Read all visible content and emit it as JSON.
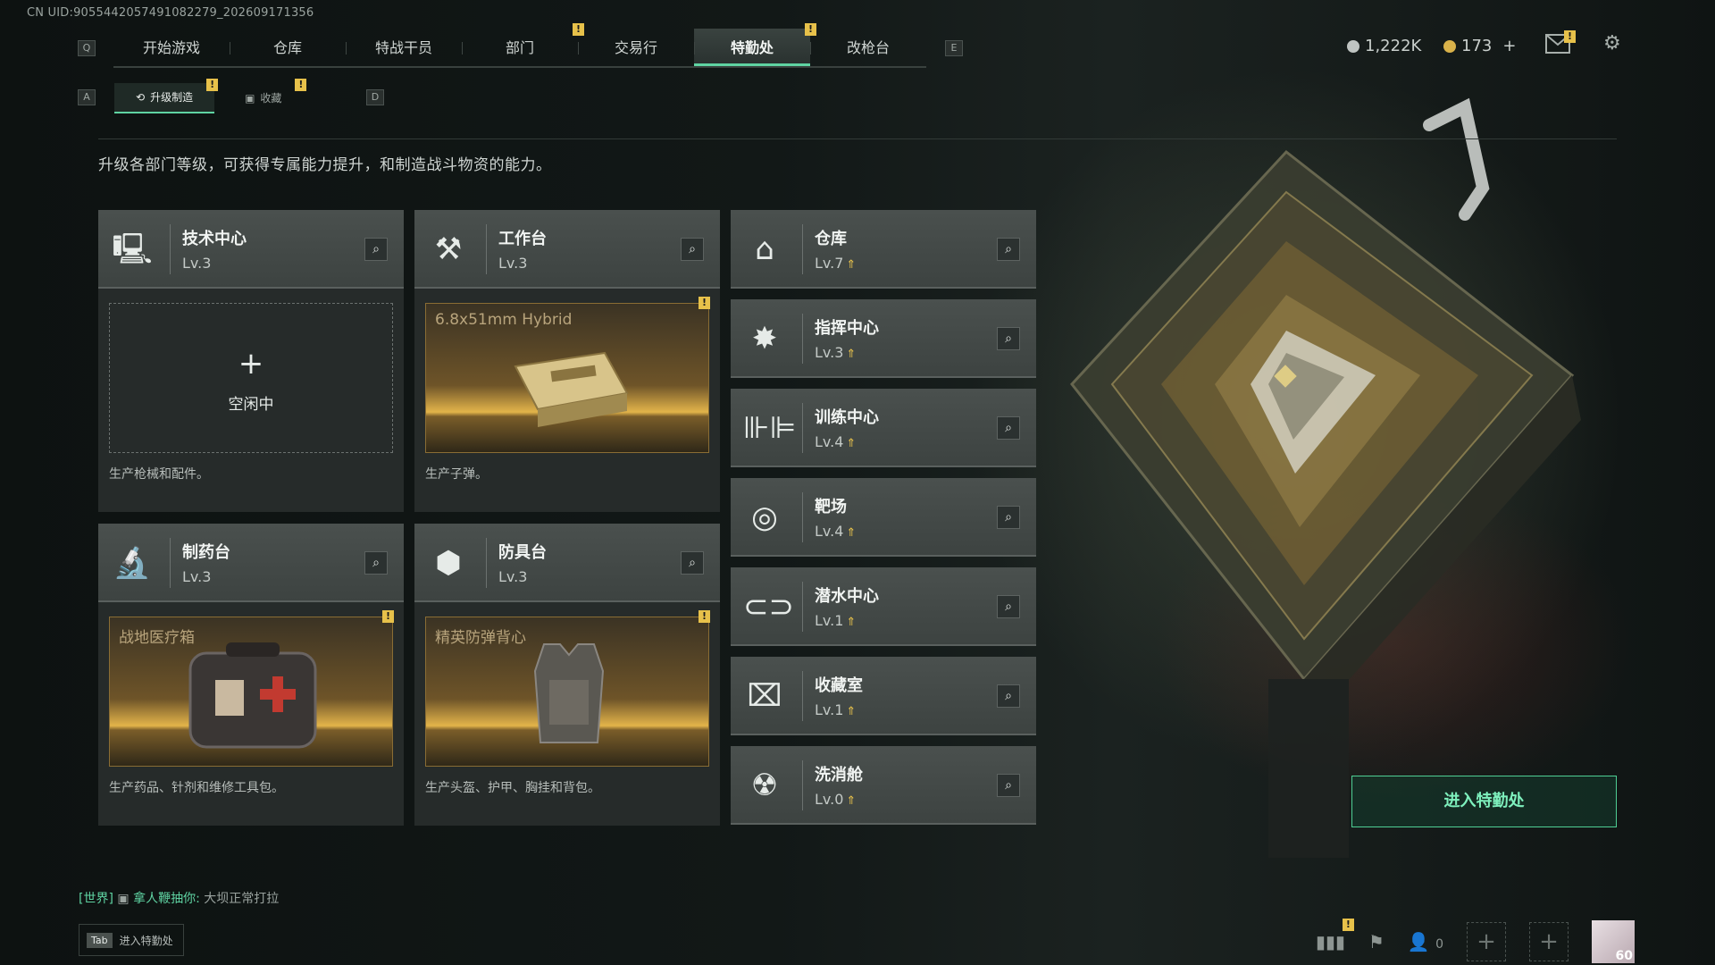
{
  "uid": "CN UID:9055442057491082279_202609171356",
  "nav": {
    "left_key": "Q",
    "right_key": "E",
    "tabs": [
      {
        "label": "开始游戏",
        "active": false,
        "badge": ""
      },
      {
        "label": "仓库",
        "active": false,
        "badge": ""
      },
      {
        "label": "特战干员",
        "active": false,
        "badge": ""
      },
      {
        "label": "部门",
        "active": false,
        "badge": "!"
      },
      {
        "label": "交易行",
        "active": false,
        "badge": ""
      },
      {
        "label": "特勤处",
        "active": true,
        "badge": "!"
      },
      {
        "label": "改枪台",
        "active": false,
        "badge": ""
      }
    ]
  },
  "currency": {
    "silver": "1,222K",
    "gold": "173",
    "gold_add": "+",
    "silver_color": "#bfc4c2",
    "gold_color": "#d9b24a"
  },
  "mail_badge": "!",
  "icons": {
    "mail": "mail-icon",
    "settings": "gear-icon"
  },
  "subnav": {
    "left_key": "A",
    "right_key": "D",
    "tabs": [
      {
        "label": "升级制造",
        "active": true,
        "badge": "!",
        "icon": "upgrade-icon"
      },
      {
        "label": "收藏",
        "active": false,
        "badge": "!",
        "icon": "collection-icon"
      }
    ]
  },
  "description": "升级各部门等级，可获得专属能力提升，和制造战斗物资的能力。",
  "production_cards": [
    {
      "name": "技术中心",
      "level": "Lv.3",
      "icon": "computer-icon",
      "state": "idle",
      "idle_label": "空闲中",
      "item": "",
      "footer": "生产枪械和配件。"
    },
    {
      "name": "工作台",
      "level": "Lv.3",
      "icon": "tools-icon",
      "state": "producing",
      "item": "6.8x51mm Hybrid",
      "footer": "生产子弹。"
    },
    {
      "name": "制药台",
      "level": "Lv.3",
      "icon": "microscope-icon",
      "state": "producing",
      "item": "战地医疗箱",
      "footer": "生产药品、针剂和维修工具包。"
    },
    {
      "name": "防具台",
      "level": "Lv.3",
      "icon": "cubes-icon",
      "state": "producing",
      "item": "精英防弹背心",
      "footer": "生产头盔、护甲、胸挂和背包。"
    }
  ],
  "facility_cards": [
    {
      "name": "仓库",
      "level": "Lv.7",
      "icon": "warehouse-icon"
    },
    {
      "name": "指挥中心",
      "level": "Lv.3",
      "icon": "command-icon"
    },
    {
      "name": "训练中心",
      "level": "Lv.4",
      "icon": "dumbbell-icon"
    },
    {
      "name": "靶场",
      "level": "Lv.4",
      "icon": "target-icon"
    },
    {
      "name": "潜水中心",
      "level": "Lv.1",
      "icon": "diving-mask-icon"
    },
    {
      "name": "收藏室",
      "level": "Lv.1",
      "icon": "display-case-icon"
    },
    {
      "name": "洗消舱",
      "level": "Lv.0",
      "icon": "radiation-icon"
    }
  ],
  "enter_button": "进入特勤处",
  "chat": {
    "channel": "[世界]",
    "sender": "拿人鞭抽你:",
    "message": "大坝正常打拉"
  },
  "tab_hint": {
    "key": "Tab",
    "label": "进入特勤处"
  },
  "bottom_bar": {
    "stats_badge": "!",
    "friends_count": "0",
    "avatar_level": "60"
  },
  "colors": {
    "accent": "#5fd3a2",
    "badge": "#e7c14a",
    "production_glow": "#e3b44a"
  }
}
